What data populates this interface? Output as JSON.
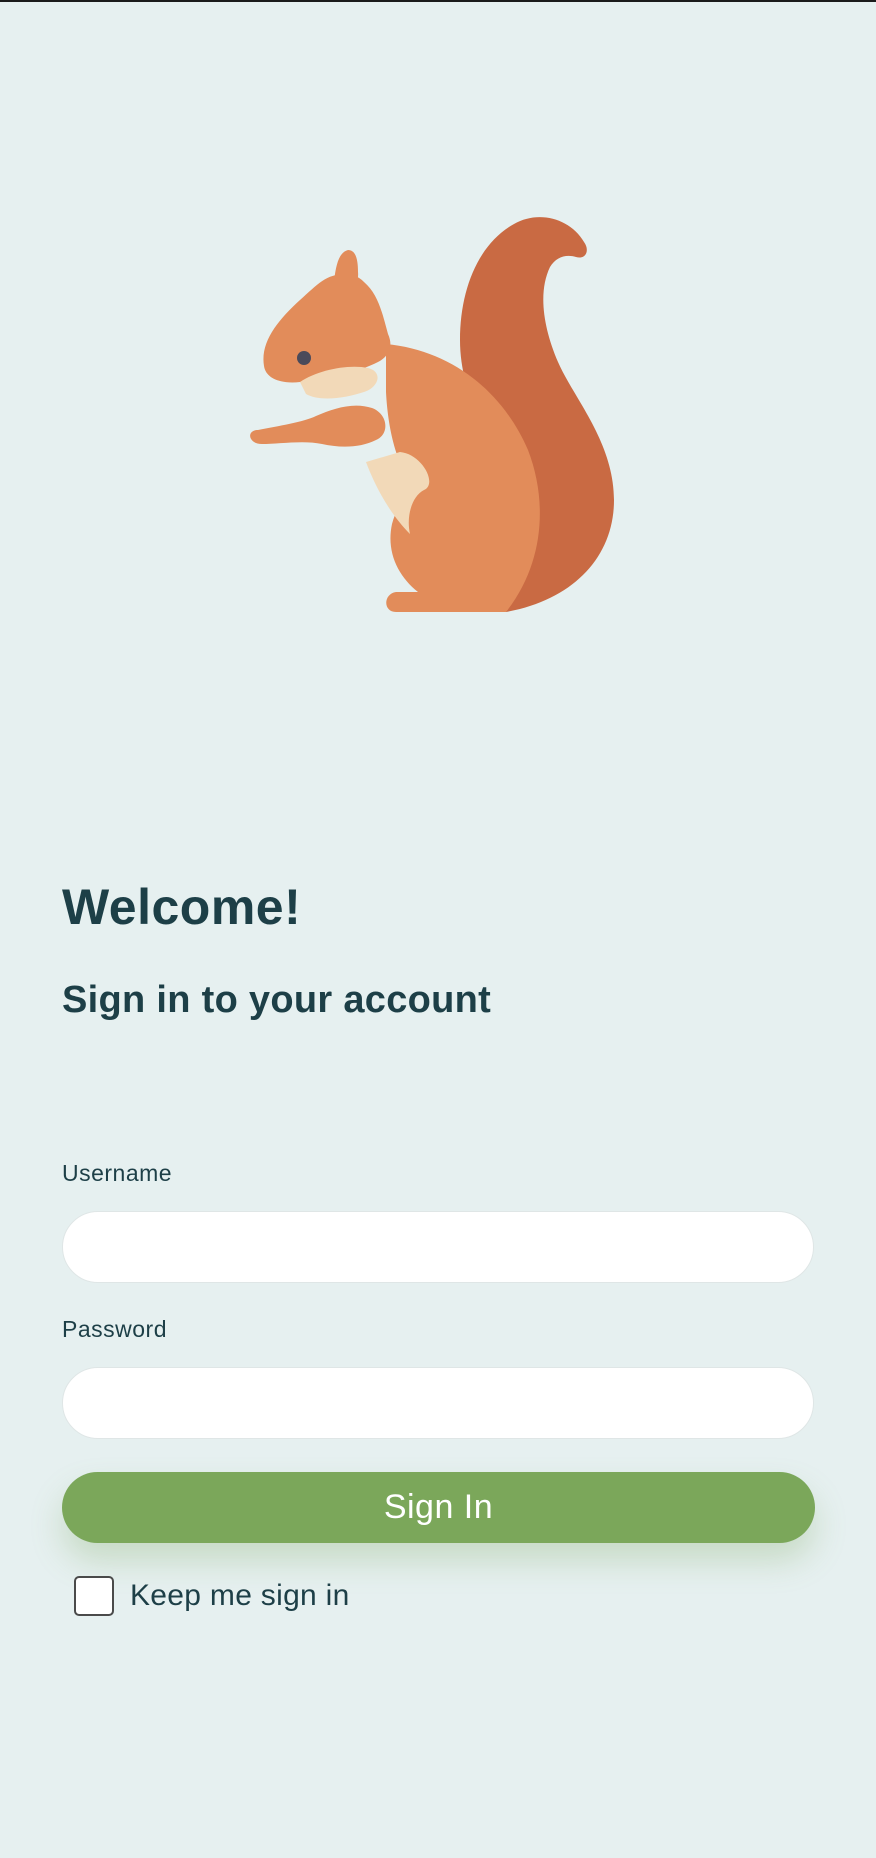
{
  "logo": {
    "icon": "squirrel-icon",
    "colors": {
      "body": "#e28c5a",
      "tail": "#c96a43",
      "belly": "#f2d9b8",
      "eye": "#4a4a5a"
    }
  },
  "header": {
    "title": "Welcome!",
    "subtitle": "Sign in to your account"
  },
  "form": {
    "username": {
      "label": "Username",
      "value": "",
      "placeholder": ""
    },
    "password": {
      "label": "Password",
      "value": "",
      "placeholder": ""
    },
    "submit_label": "Sign In",
    "remember": {
      "label": "Keep me sign in",
      "checked": false
    }
  },
  "colors": {
    "background": "#e6f0f0",
    "text": "#1d3f47",
    "accent": "#7ba75a"
  }
}
